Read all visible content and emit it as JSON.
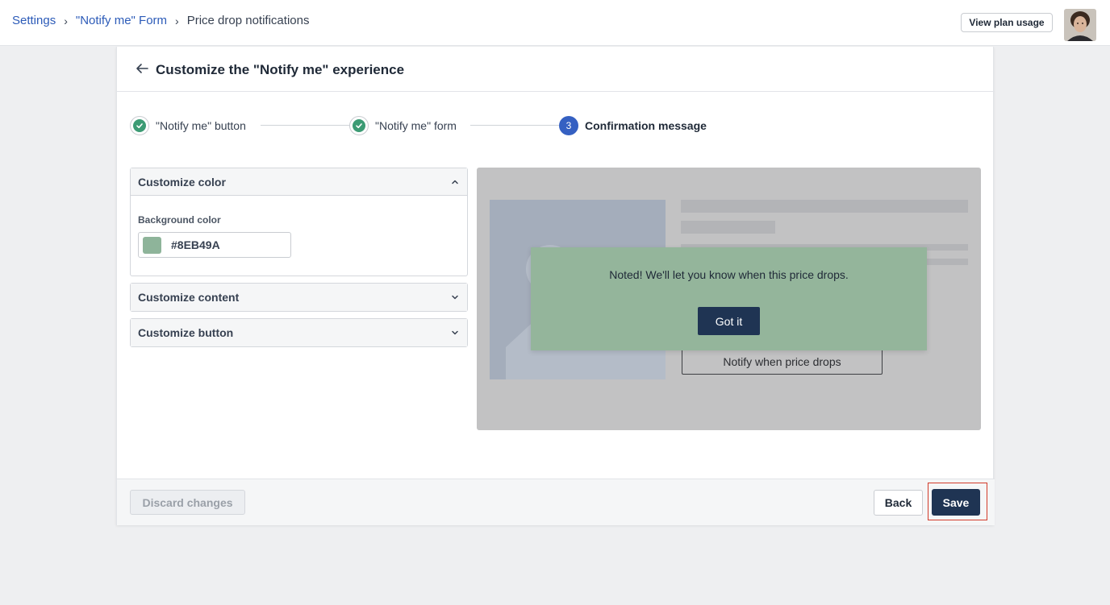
{
  "breadcrumb": {
    "items": [
      "Settings",
      "\"Notify me\" Form"
    ],
    "current": "Price drop notifications",
    "separator": "›"
  },
  "header": {
    "plan_button": "View plan usage",
    "avatar_icon": "user-avatar"
  },
  "card": {
    "title": "Customize the \"Notify me\" experience",
    "back_icon": "arrow-left-icon"
  },
  "stepper": {
    "steps": [
      {
        "label": "\"Notify me\" button",
        "state": "done"
      },
      {
        "label": "\"Notify me\" form",
        "state": "done"
      },
      {
        "label": "Confirmation message",
        "state": "active",
        "number": "3"
      }
    ]
  },
  "accordions": {
    "color": {
      "title": "Customize color",
      "expanded": true,
      "field_label": "Background color",
      "value": "#8EB49A"
    },
    "content": {
      "title": "Customize content",
      "expanded": false
    },
    "button": {
      "title": "Customize button",
      "expanded": false
    }
  },
  "preview": {
    "notify_button": "Notify when price drops",
    "toast": {
      "message": "Noted! We'll let you know when this price drops.",
      "button": "Got it",
      "background": "#94B59B"
    }
  },
  "footer": {
    "discard": "Discard changes",
    "back": "Back",
    "save": "Save"
  },
  "colors": {
    "accent": "#3560C2",
    "link": "#2C5BB8",
    "primary_button": "#1F3453",
    "success": "#3C9B74",
    "highlight_outline": "#D23B2A"
  }
}
